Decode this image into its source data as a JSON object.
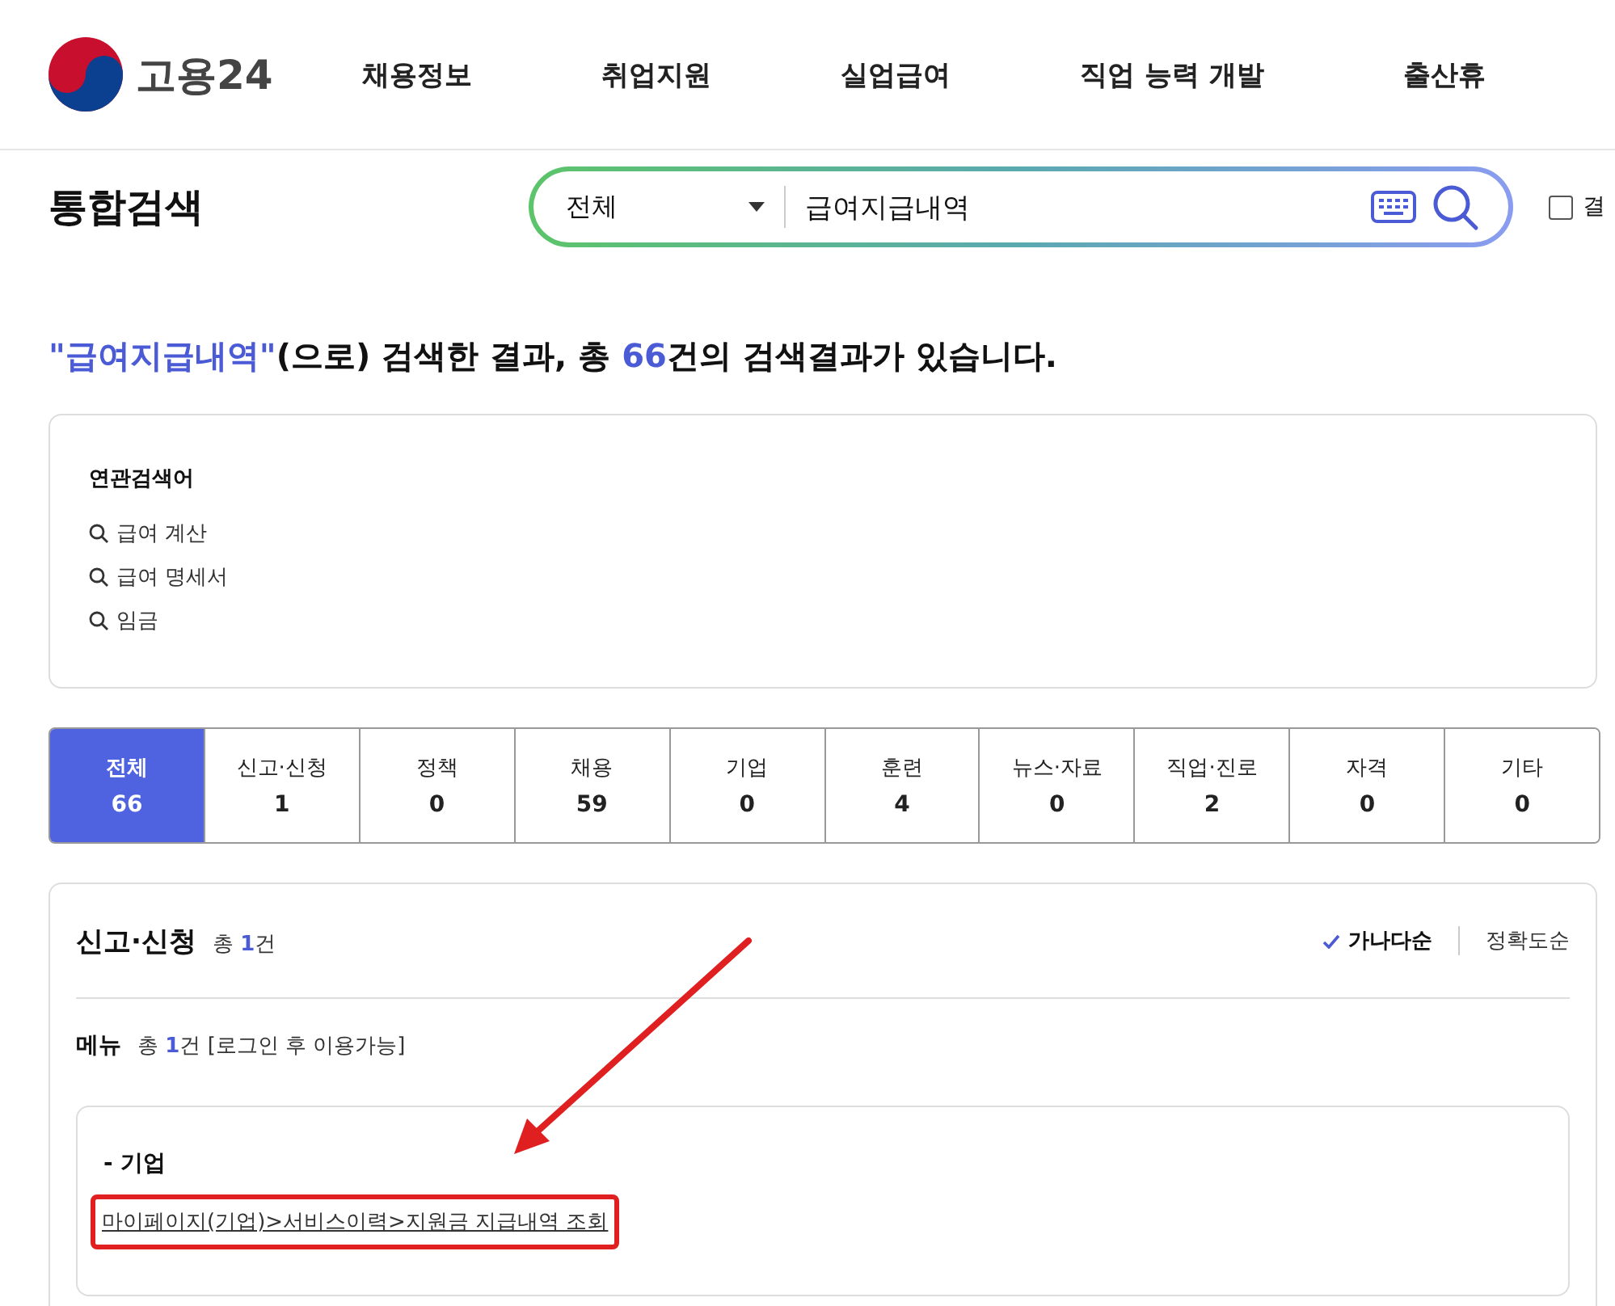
{
  "header": {
    "logo_text": "고용24",
    "nav": [
      "채용정보",
      "취업지원",
      "실업급여",
      "직업 능력 개발",
      "출산휴"
    ]
  },
  "search_bar": {
    "title": "통합검색",
    "scope": "전체",
    "query": "급여지급내역",
    "result_search": {
      "label": "결",
      "checked": false
    }
  },
  "summary": "**\"급여지급내역\"**(으로) 검색한 결과, 총 **66**건의 검색결과가 있습니다.",
  "related": {
    "title": "연관검색어",
    "items": [
      "급여 계산",
      "급여 명세서",
      "임금"
    ]
  },
  "tabs": [
    {
      "label": "전체",
      "count": "66",
      "selected": true
    },
    {
      "label": "신고·신청",
      "count": "1",
      "selected": false
    },
    {
      "label": "정책",
      "count": "0",
      "selected": false
    },
    {
      "label": "채용",
      "count": "59",
      "selected": false
    },
    {
      "label": "기업",
      "count": "0",
      "selected": false
    },
    {
      "label": "훈련",
      "count": "4",
      "selected": false
    },
    {
      "label": "뉴스·자료",
      "count": "0",
      "selected": false
    },
    {
      "label": "직업·진로",
      "count": "2",
      "selected": false
    },
    {
      "label": "자격",
      "count": "0",
      "selected": false
    },
    {
      "label": "기타",
      "count": "0",
      "selected": false
    }
  ],
  "section": {
    "title": "신고·신청",
    "total_prefix": "총",
    "total": "1",
    "total_suffix": "건",
    "sort": [
      {
        "label": "가나다순",
        "selected": true
      },
      {
        "label": "정확도순",
        "selected": false
      }
    ],
    "menu": {
      "title": "메뉴",
      "total_prefix": "총",
      "total": "1",
      "total_suffix": "건",
      "note": "[로그인 후 이용가능]",
      "result": {
        "category": "- 기업",
        "link": "마이페이지(기업)>서비스이력>지원금 지급내역 조회",
        "highlighted": true
      }
    }
  }
}
